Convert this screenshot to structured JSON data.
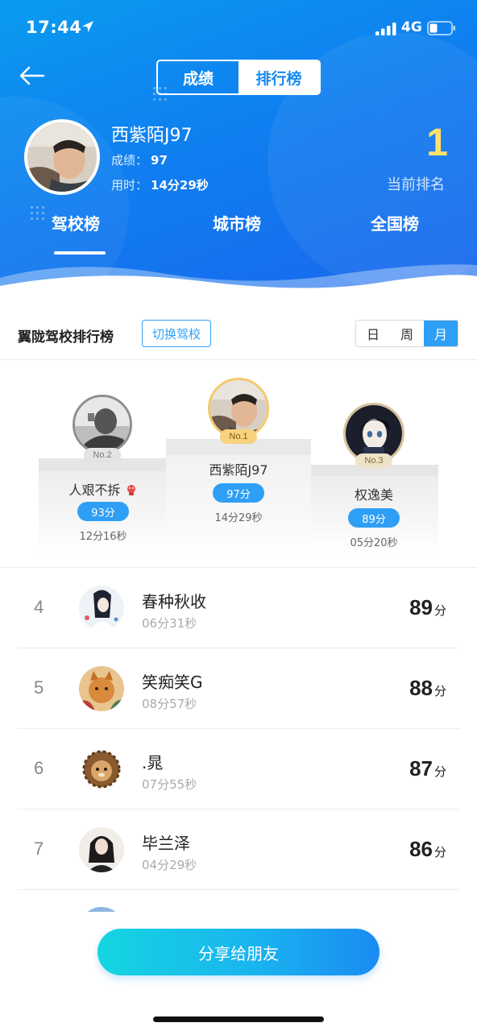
{
  "status_bar": {
    "time": "17:44",
    "network": "4G"
  },
  "header": {
    "segment": {
      "left_label": "成绩",
      "right_label": "排行榜",
      "active": "排行榜"
    },
    "me": {
      "name": "西紫陌J97",
      "score_label": "成绩：",
      "score": "97",
      "time_label": "用时：",
      "time": "14分29秒",
      "rank": "1",
      "rank_label": "当前排名"
    },
    "tabs": [
      {
        "label": "驾校榜",
        "active": true
      },
      {
        "label": "城市榜",
        "active": false
      },
      {
        "label": "全国榜",
        "active": false
      }
    ]
  },
  "board": {
    "title": "翼陇驾校排行榜",
    "switch_label": "切换驾校",
    "periods": [
      "日",
      "周",
      "月"
    ],
    "active_period": "月"
  },
  "podium": [
    {
      "badge": "No.1",
      "name": "西紫陌J97",
      "score": "97分",
      "time": "14分29秒"
    },
    {
      "badge": "No.2",
      "name": "人艰不拆",
      "score": "93分",
      "time": "12分16秒"
    },
    {
      "badge": "No.3",
      "name": "权逸美",
      "score": "89分",
      "time": "05分20秒"
    }
  ],
  "list": [
    {
      "rank": "4",
      "name": "春种秋收",
      "time": "06分31秒",
      "score": "89",
      "unit": "分"
    },
    {
      "rank": "5",
      "name": "笑痴笑G",
      "time": "08分57秒",
      "score": "88",
      "unit": "分"
    },
    {
      "rank": "6",
      "name": ".晁",
      "time": "07分55秒",
      "score": "87",
      "unit": "分"
    },
    {
      "rank": "7",
      "name": "毕兰泽",
      "time": "04分29秒",
      "score": "86",
      "unit": "分"
    }
  ],
  "share_label": "分享给朋友",
  "colors": {
    "primary": "#2f9ff5",
    "header_blue": "#0f7ff0",
    "rank_gold": "#ffe16a"
  }
}
